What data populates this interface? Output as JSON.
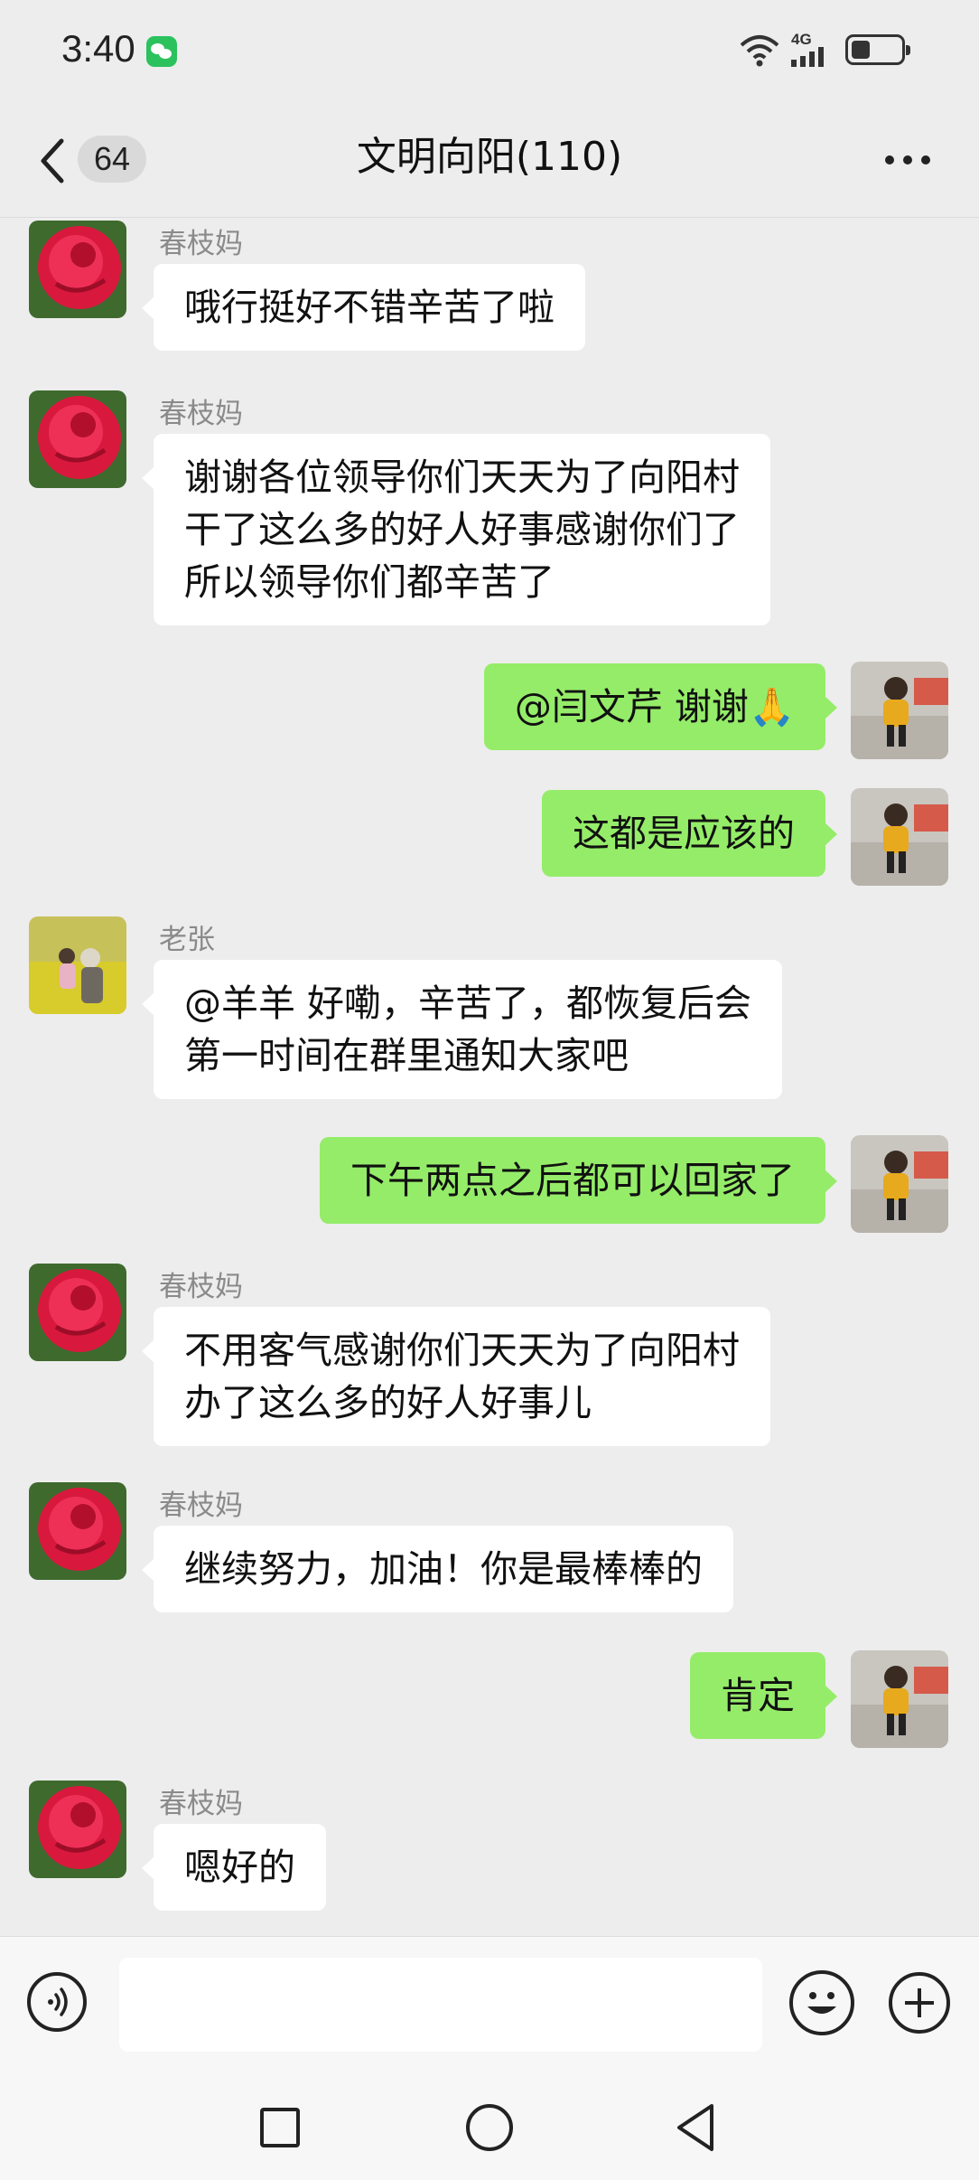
{
  "status_bar": {
    "time": "3:40",
    "network": "4G",
    "icons": [
      "wechat-icon",
      "wifi-icon",
      "signal-icon",
      "battery-icon"
    ]
  },
  "header": {
    "unread_count": "64",
    "title": "文明向阳(110)"
  },
  "messages": [
    {
      "side": "in",
      "sender": "春枝妈",
      "avatar": "rose",
      "text": "哦行挺好不错辛苦了啦"
    },
    {
      "side": "in",
      "sender": "春枝妈",
      "avatar": "rose",
      "lines": [
        "谢谢各位领导你们天天为了向阳村",
        "干了这么多的好人好事感谢你们了",
        "所以领导你们都辛苦了"
      ]
    },
    {
      "side": "out",
      "avatar": "child",
      "text": "@闫文芹  谢谢",
      "emoji": "🙏"
    },
    {
      "side": "out",
      "avatar": "child",
      "text": "这都是应该的"
    },
    {
      "side": "in",
      "sender": "老张",
      "avatar": "field",
      "lines": [
        "@羊羊  好嘞，辛苦了，都恢复后会",
        "第一时间在群里通知大家吧"
      ]
    },
    {
      "side": "out",
      "avatar": "child",
      "text": "下午两点之后都可以回家了"
    },
    {
      "side": "in",
      "sender": "春枝妈",
      "avatar": "rose",
      "lines": [
        "不用客气感谢你们天天为了向阳村",
        "办了这么多的好人好事儿"
      ]
    },
    {
      "side": "in",
      "sender": "春枝妈",
      "avatar": "rose",
      "text": "继续努力，加油！你是最棒棒的"
    },
    {
      "side": "out",
      "avatar": "child",
      "text": "肯定"
    },
    {
      "side": "in",
      "sender": "春枝妈",
      "avatar": "rose",
      "text": "嗯好的"
    }
  ],
  "input_bar": {
    "placeholder": "",
    "icons": [
      "voice-icon",
      "emoji-icon",
      "plus-icon"
    ]
  },
  "system_nav": [
    "recent-apps-icon",
    "home-icon",
    "back-icon"
  ],
  "colors": {
    "background": "#ededed",
    "outgoing_bubble": "#95ec69",
    "incoming_bubble": "#ffffff",
    "wechat_green": "#2bc25d"
  }
}
